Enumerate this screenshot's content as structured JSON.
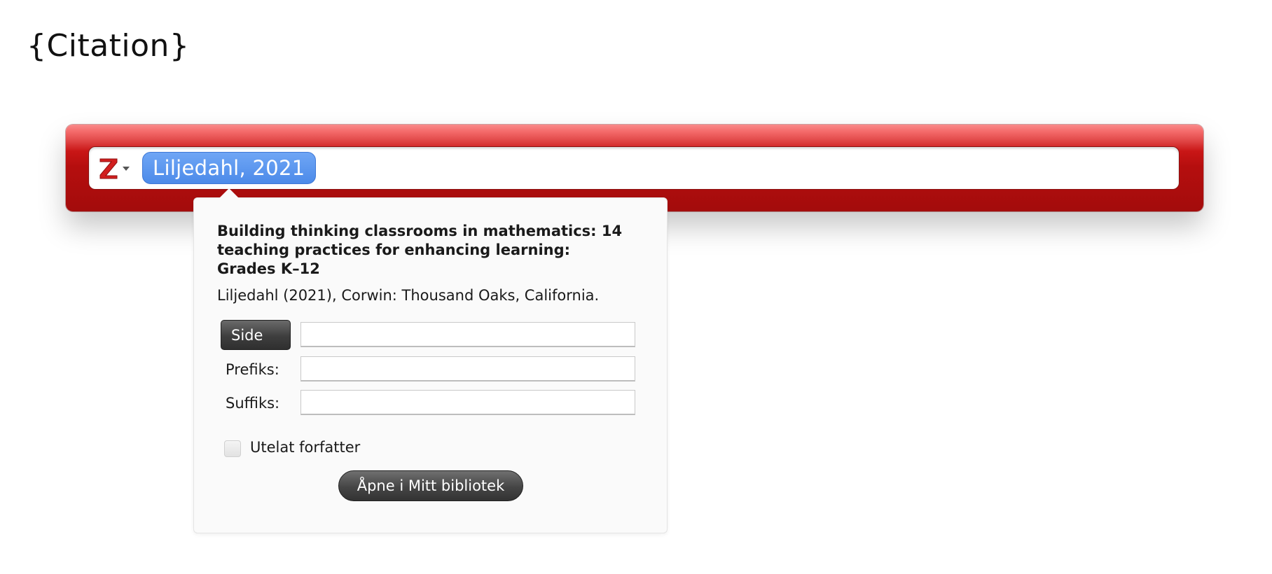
{
  "document": {
    "field_text": "{Citation}"
  },
  "citation_bar": {
    "menu_icon": "zotero-z-icon",
    "bubble_label": "Liljedahl, 2021"
  },
  "panel": {
    "title": "Building thinking classrooms in mathematics: 14 teaching practices for enhancing learning: Grades K–12",
    "meta": "Liljedahl (2021), Corwin: Thousand Oaks, California.",
    "locator_label": "Side",
    "locator_value": "",
    "prefix_label": "Prefiks:",
    "prefix_value": "",
    "suffix_label": "Suffiks:",
    "suffix_value": "",
    "omit_author_label": "Utelat forfatter",
    "omit_author_checked": false,
    "open_button_label": "Åpne i Mitt bibliotek"
  },
  "colors": {
    "bar_red": "#b50e0e",
    "bubble_blue": "#4c8ae9",
    "zotero_red": "#d21f1f"
  }
}
